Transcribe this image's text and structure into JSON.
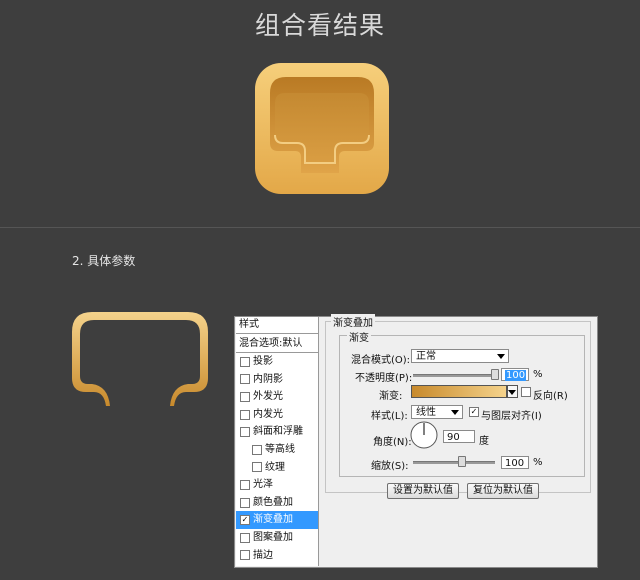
{
  "page": {
    "title": "组合看结果",
    "subheading": "2. 具体参数"
  },
  "colors": {
    "background": "#3e3e3e",
    "gold_light": "#f2c772",
    "gold_dark": "#c88a2c",
    "selection_blue": "#3399ff"
  },
  "styles_list": {
    "header": "样式",
    "blend_options": "混合选项:默认",
    "items": [
      {
        "label": "投影",
        "checked": false,
        "indent": false
      },
      {
        "label": "内阴影",
        "checked": false,
        "indent": false
      },
      {
        "label": "外发光",
        "checked": false,
        "indent": false
      },
      {
        "label": "内发光",
        "checked": false,
        "indent": false
      },
      {
        "label": "斜面和浮雕",
        "checked": false,
        "indent": false
      },
      {
        "label": "等高线",
        "checked": false,
        "indent": true
      },
      {
        "label": "纹理",
        "checked": false,
        "indent": true
      },
      {
        "label": "光泽",
        "checked": false,
        "indent": false
      },
      {
        "label": "颜色叠加",
        "checked": false,
        "indent": false
      },
      {
        "label": "渐变叠加",
        "checked": true,
        "indent": false,
        "selected": true
      },
      {
        "label": "图案叠加",
        "checked": false,
        "indent": false
      },
      {
        "label": "描边",
        "checked": false,
        "indent": false
      }
    ]
  },
  "gradient_overlay": {
    "section_title": "渐变叠加",
    "group_title": "渐变",
    "blend_mode_label": "混合模式(O):",
    "blend_mode_value": "正常",
    "opacity_label": "不透明度(P):",
    "opacity_value": "100",
    "opacity_percent": 100,
    "percent_sign": "%",
    "gradient_label": "渐变:",
    "reverse_label": "反向(R)",
    "reverse_checked": false,
    "style_label": "样式(L):",
    "style_value": "线性",
    "align_label": "与图层对齐(I)",
    "align_checked": true,
    "angle_label": "角度(N):",
    "angle_value": "90",
    "angle_unit": "度",
    "scale_label": "缩放(S):",
    "scale_value": "100",
    "scale_percent": 100,
    "set_default_button": "设置为默认值",
    "reset_default_button": "复位为默认值"
  }
}
